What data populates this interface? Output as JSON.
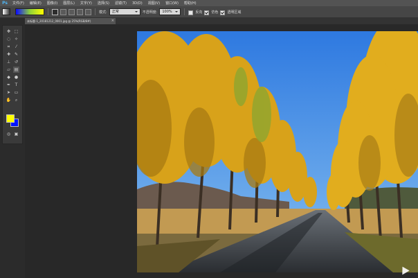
{
  "menubar": {
    "logo": "Ps",
    "items": [
      "文件(F)",
      "编辑(E)",
      "图像(I)",
      "图层(L)",
      "文字(Y)",
      "选择(S)",
      "滤镜(T)",
      "3D(D)",
      "视图(V)",
      "窗口(W)",
      "帮助(H)"
    ]
  },
  "options": {
    "mode_label": "模式:",
    "mode_value": "正常",
    "opacity_label": "不透明度:",
    "opacity_value": "100%",
    "reverse_label": "反向",
    "dither_label": "仿色",
    "transparency_label": "透明区域"
  },
  "document": {
    "tab_title": "未标题-1_20181212_0001.jpg @ 25%(RGB/8#)"
  },
  "colors": {
    "foreground": "#ffff00",
    "background": "#0014ff"
  },
  "tools": [
    "move-icon",
    "marquee-icon",
    "lasso-icon",
    "magic-wand-icon",
    "crop-icon",
    "eyedropper-icon",
    "heal-icon",
    "brush-icon",
    "stamp-icon",
    "history-brush-icon",
    "eraser-icon",
    "gradient-icon",
    "blur-icon",
    "dodge-icon",
    "pen-icon",
    "type-icon",
    "path-select-icon",
    "shape-icon",
    "hand-icon",
    "zoom-icon"
  ]
}
